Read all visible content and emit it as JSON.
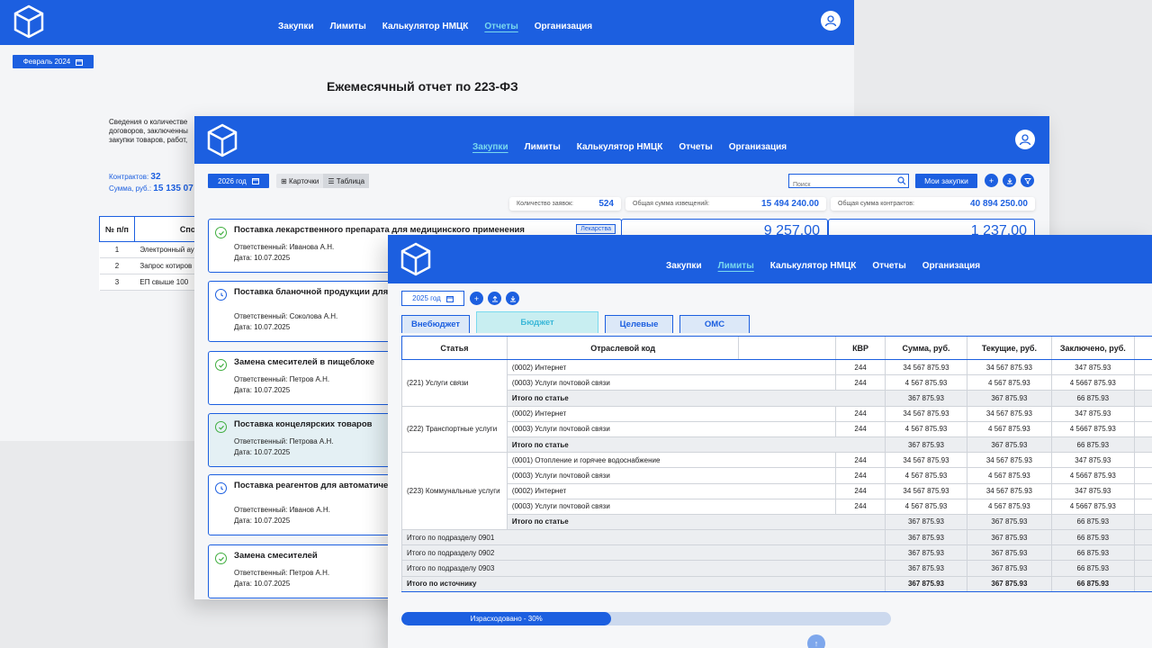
{
  "app": {
    "nav": [
      "Закупки",
      "Лимиты",
      "Калькулятор НМЦК",
      "Отчеты",
      "Организация"
    ]
  },
  "reports": {
    "active_nav": 3,
    "period": "Февраль 2024",
    "title": "Ежемесячный отчет по 223-ФЗ",
    "description": [
      "Сведения о количестве",
      "договоров, заключенны",
      "закупки товаров, работ,"
    ],
    "contracts_label": "Контрактов:",
    "contracts_value": "32",
    "sum_label": "Сумма, руб.:",
    "sum_value": "15 135 07",
    "table_headers": [
      "№ п/п",
      "Спос"
    ],
    "rows": [
      {
        "n": "1",
        "method": "Электронный ау"
      },
      {
        "n": "2",
        "method": "Запрос котиров"
      },
      {
        "n": "3",
        "method": "ЕП свыше 100"
      }
    ]
  },
  "purchases": {
    "active_nav": 0,
    "year": "2026 год",
    "view_cards": "Карточки",
    "view_table": "Таблица",
    "search_placeholder": "Поиск",
    "my_purchases": "Мои закупки",
    "stats": [
      {
        "label": "Количество заявок:",
        "value": "524"
      },
      {
        "label": "Общая сумма извещений:",
        "value": "15 494 240.00"
      },
      {
        "label": "Общая сумма контрактов:",
        "value": "40 894 250.00"
      }
    ],
    "big_values": [
      "9 257.00",
      "1 237.00"
    ],
    "cards": [
      {
        "title": "Поставка лекарственного препарата для медицинского применения",
        "tag": "Лекарства",
        "person": "Ответственный: Иванова А.Н.",
        "date": "Дата: 10.07.2025",
        "status": "done"
      },
      {
        "title": "Поставка бланочной продукции для о приема пациентов",
        "person": "Ответственный: Соколова А.Н.",
        "date": "Дата: 10.07.2025",
        "status": "pending"
      },
      {
        "title": "Замена смесителей в пищеблоке",
        "person": "Ответственный: Петров А.Н.",
        "date": "Дата: 10.07.2025",
        "status": "done"
      },
      {
        "title": "Поставка концелярских товаров",
        "person": "Ответственный: Петрова А.Н.",
        "date": "Дата: 10.07.2025",
        "status": "done"
      },
      {
        "title": "Поставка реагентов для автоматичес анализатора",
        "person": "Ответственный: Иванов А.Н.",
        "date": "Дата: 10.07.2025",
        "status": "pending"
      },
      {
        "title": "Замена смесителей",
        "person": "Ответственный: Петров А.Н.",
        "date": "Дата: 10.07.2025",
        "status": "done"
      }
    ]
  },
  "limits": {
    "active_nav": 1,
    "year": "2025 год",
    "tabs": [
      "Внебюджет",
      "Бюджет",
      "Целевые",
      "ОМС"
    ],
    "active_tab": 1,
    "headers": [
      "Статья",
      "Отраслевой код",
      "",
      "КВР",
      "Сумма, руб.",
      "Текущие,  руб.",
      "Заключено, руб."
    ],
    "total_label": "Итого по статье",
    "groups": [
      {
        "article": "(221) Услуги связи",
        "rows": [
          {
            "code": "(0002) Интернет",
            "kvr": "244",
            "sum": "34 567 875.93",
            "cur": "34 567 875.93",
            "done": "347 875.93"
          },
          {
            "code": "(0003) Услуги почтовой связи",
            "kvr": "244",
            "sum": "4 567 875.93",
            "cur": "4 567 875.93",
            "done": "4 5667 875.93"
          }
        ],
        "total": {
          "sum": "367 875.93",
          "cur": "367 875.93",
          "done": "66 875.93"
        }
      },
      {
        "article": "(222) Транспортные услуги",
        "rows": [
          {
            "code": "(0002) Интернет",
            "kvr": "244",
            "sum": "34 567 875.93",
            "cur": "34 567 875.93",
            "done": "347 875.93"
          },
          {
            "code": "(0003) Услуги почтовой связи",
            "kvr": "244",
            "sum": "4 567 875.93",
            "cur": "4 567 875.93",
            "done": "4 5667 875.93"
          }
        ],
        "total": {
          "sum": "367 875.93",
          "cur": "367 875.93",
          "done": "66 875.93"
        }
      },
      {
        "article": "(223) Коммунальные услуги",
        "rows": [
          {
            "code": "(0001) Отопление и горячее водоснабжение",
            "kvr": "244",
            "sum": "34 567 875.93",
            "cur": "34 567 875.93",
            "done": "347 875.93"
          },
          {
            "code": "(0003) Услуги почтовой связи",
            "kvr": "244",
            "sum": "4 567 875.93",
            "cur": "4 567 875.93",
            "done": "4 5667 875.93"
          },
          {
            "code": "(0002) Интернет",
            "kvr": "244",
            "sum": "34 567 875.93",
            "cur": "34 567 875.93",
            "done": "347 875.93"
          },
          {
            "code": "(0003) Услуги почтовой связи",
            "kvr": "244",
            "sum": "4 567 875.93",
            "cur": "4 567 875.93",
            "done": "4 5667 875.93"
          }
        ],
        "total": {
          "sum": "367 875.93",
          "cur": "367 875.93",
          "done": "66 875.93"
        }
      }
    ],
    "subdivisions": [
      {
        "label": "Итого по подразделу 0901",
        "sum": "367 875.93",
        "cur": "367 875.93",
        "done": "66 875.93"
      },
      {
        "label": "Итого по подразделу 0902",
        "sum": "367 875.93",
        "cur": "367 875.93",
        "done": "66 875.93"
      },
      {
        "label": "Итого по подразделу 0903",
        "sum": "367 875.93",
        "cur": "367 875.93",
        "done": "66 875.93"
      }
    ],
    "source_total": {
      "label": "Итого по источнику",
      "sum": "367 875.93",
      "cur": "367 875.93",
      "done": "66 875.93"
    },
    "progress_label": "Израсходовано - 30%",
    "progress_fraction": 0.3
  },
  "colors": {
    "primary": "#1c5fe0",
    "accent": "#79d9ee",
    "success": "#3fae3f"
  }
}
